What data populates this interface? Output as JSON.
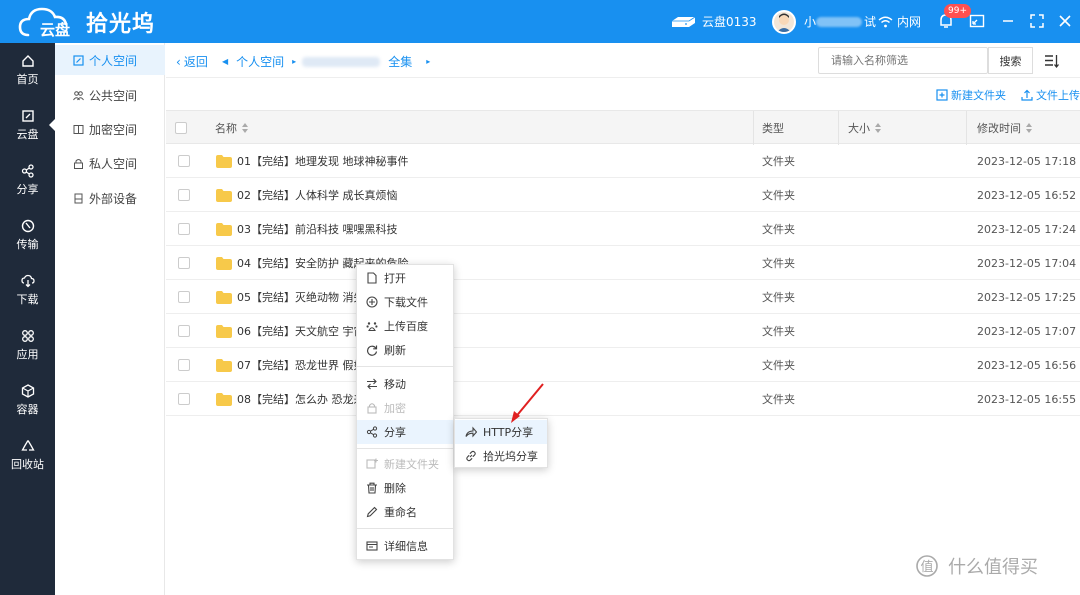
{
  "app": {
    "logo_sub": "云盘",
    "logo_name": "拾光坞",
    "brand_color": "#1890f0"
  },
  "topbar": {
    "disk_label": "云盘0133",
    "user_prefix": "小",
    "user_suffix": "试",
    "network_label": "内网",
    "notif_badge": "99+"
  },
  "leftnav": [
    {
      "label": "首页",
      "icon": "home-icon"
    },
    {
      "label": "云盘",
      "icon": "cloud-disk-icon"
    },
    {
      "label": "分享",
      "icon": "share-icon"
    },
    {
      "label": "传输",
      "icon": "transfer-icon"
    },
    {
      "label": "下载",
      "icon": "download-icon"
    },
    {
      "label": "应用",
      "icon": "apps-icon"
    },
    {
      "label": "容器",
      "icon": "container-icon"
    },
    {
      "label": "回收站",
      "icon": "recycle-icon"
    }
  ],
  "spaces": [
    {
      "label": "个人空间",
      "icon": "personal-space-icon"
    },
    {
      "label": "公共空间",
      "icon": "public-space-icon"
    },
    {
      "label": "加密空间",
      "icon": "encrypted-space-icon"
    },
    {
      "label": "私人空间",
      "icon": "private-space-icon"
    },
    {
      "label": "外部设备",
      "icon": "external-device-icon"
    }
  ],
  "toolbar": {
    "back_label": "返回",
    "crumb_root": "个人空间",
    "crumb_leaf": "全集",
    "search_placeholder": "请输入名称筛选",
    "search_button": "搜索"
  },
  "actions": {
    "new_folder": "新建文件夹",
    "upload": "文件上传"
  },
  "table": {
    "headers": {
      "name": "名称",
      "type": "类型",
      "size": "大小",
      "modified": "修改时间"
    },
    "rows": [
      {
        "name": "01【完结】地理发现 地球神秘事件",
        "type": "文件夹",
        "modified": "2023-12-05 17:18"
      },
      {
        "name": "02【完结】人体科学 成长真烦恼",
        "type": "文件夹",
        "modified": "2023-12-05 16:52"
      },
      {
        "name": "03【完结】前沿科技 嘿嘿黑科技",
        "type": "文件夹",
        "modified": "2023-12-05 17:24"
      },
      {
        "name": "04【完结】安全防护 藏起来的危险",
        "type": "文件夹",
        "modified": "2023-12-05 17:04"
      },
      {
        "name": "05【完结】灭绝动物 消失的",
        "type": "文件夹",
        "modified": "2023-12-05 17:25"
      },
      {
        "name": "06【完结】天文航空 宇宙",
        "type": "文件夹",
        "modified": "2023-12-05 17:07"
      },
      {
        "name": "07【完结】恐龙世界 假如",
        "type": "文件夹",
        "modified": "2023-12-05 16:56"
      },
      {
        "name": "08【完结】怎么办 恐龙来",
        "type": "文件夹",
        "modified": "2023-12-05 16:55"
      }
    ]
  },
  "context_menu": {
    "items": [
      {
        "label": "打开",
        "icon": "open-icon"
      },
      {
        "label": "下载文件",
        "icon": "download-file-icon"
      },
      {
        "label": "上传百度",
        "icon": "baidu-upload-icon"
      },
      {
        "label": "刷新",
        "icon": "refresh-icon"
      },
      {
        "label": "移动",
        "icon": "move-icon"
      },
      {
        "label": "加密",
        "icon": "lock-icon"
      },
      {
        "label": "分享",
        "icon": "share-icon"
      },
      {
        "label": "新建文件夹",
        "icon": "new-folder-icon"
      },
      {
        "label": "删除",
        "icon": "trash-icon"
      },
      {
        "label": "重命名",
        "icon": "rename-icon"
      },
      {
        "label": "详细信息",
        "icon": "details-icon"
      }
    ],
    "submenu": [
      {
        "label": "HTTP分享",
        "icon": "http-share-icon"
      },
      {
        "label": "拾光坞分享",
        "icon": "link-icon"
      }
    ]
  },
  "watermark": "什么值得买"
}
